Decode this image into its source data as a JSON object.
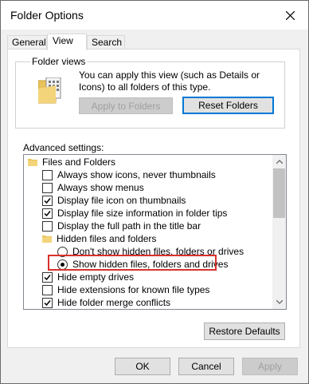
{
  "window": {
    "title": "Folder Options",
    "close_icon": "close-icon"
  },
  "tabs": [
    {
      "label": "General",
      "active": false
    },
    {
      "label": "View",
      "active": true
    },
    {
      "label": "Search",
      "active": false
    }
  ],
  "folder_views": {
    "label": "Folder views",
    "description": "You can apply this view (such as Details or Icons) to all folders of this type.",
    "apply_button": "Apply to Folders",
    "reset_button": "Reset Folders",
    "icon": "folder-view-icon"
  },
  "advanced": {
    "label": "Advanced settings:",
    "items": [
      {
        "type": "folder",
        "label": "Files and Folders"
      },
      {
        "type": "checkbox",
        "checked": false,
        "label": "Always show icons, never thumbnails"
      },
      {
        "type": "checkbox",
        "checked": false,
        "label": "Always show menus"
      },
      {
        "type": "checkbox",
        "checked": true,
        "label": "Display file icon on thumbnails"
      },
      {
        "type": "checkbox",
        "checked": true,
        "label": "Display file size information in folder tips"
      },
      {
        "type": "checkbox",
        "checked": false,
        "label": "Display the full path in the title bar"
      },
      {
        "type": "folder",
        "label": "Hidden files and folders"
      },
      {
        "type": "radio",
        "selected": false,
        "label": "Don't show hidden files, folders or drives"
      },
      {
        "type": "radio",
        "selected": true,
        "label": "Show hidden files, folders and drives"
      },
      {
        "type": "checkbox",
        "checked": true,
        "label": "Hide empty drives"
      },
      {
        "type": "checkbox",
        "checked": false,
        "label": "Hide extensions for known file types"
      },
      {
        "type": "checkbox",
        "checked": true,
        "label": "Hide folder merge conflicts"
      }
    ]
  },
  "buttons": {
    "restore": "Restore Defaults",
    "ok": "OK",
    "cancel": "Cancel",
    "apply": "Apply"
  },
  "colors": {
    "highlight": "#d9312b",
    "focus": "#0078d7"
  }
}
